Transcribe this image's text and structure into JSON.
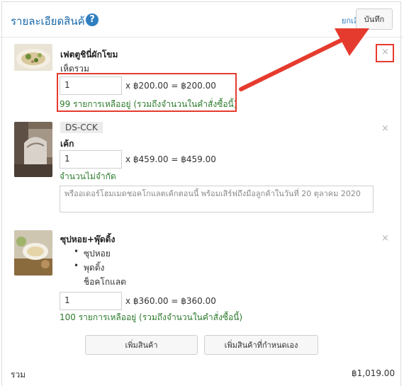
{
  "header": {
    "title": "รายละเอียดสินค้า",
    "help_glyph": "?",
    "cancel_label": "ยกเลิก",
    "save_label": "บันทึก"
  },
  "items": [
    {
      "name": "เฟตตูชินี่ผักโขม",
      "variant": "เห็ดรวม",
      "quantity": "1",
      "calc": "x ฿200.00 = ฿200.00",
      "stock": "99 รายการเหลืออยู่ (รวมถึงจำนวนในคำสั่งซื้อนี้)",
      "remove_glyph": "×"
    },
    {
      "sku": "DS-CCK",
      "name": "เค้ก",
      "quantity": "1",
      "calc": "x ฿459.00 = ฿459.00",
      "stock": "จำนวนไม่จำกัด",
      "note": "พรีออเดอร์โฮมเมดชอคโกแลตเค้กตอนนี้ พร้อมเสิร์ฟถึงมือลูกค้าในวันที่ 20 ตุลาคม 2020",
      "remove_glyph": "×"
    },
    {
      "name": "ซุปหอย+พุ๊ดดิ้ง",
      "options": [
        "ซุปหอย",
        "พุดดิ้ง"
      ],
      "option_sub": "ช็อคโกแลต",
      "quantity": "1",
      "calc": "x ฿360.00 = ฿360.00",
      "stock": "100 รายการเหลืออยู่ (รวมถึงจำนวนในคำสั่งซื้อนี้)",
      "remove_glyph": "×"
    }
  ],
  "actions": {
    "add_product": "เพิ่มสินค้า",
    "add_custom_product": "เพิ่มสินค้าที่กำหนดเอง"
  },
  "summary": {
    "total_label": "รวม",
    "total_value": "฿1,019.00"
  },
  "colors": {
    "link": "#2f7fc1",
    "stock_text": "#2d7b2d",
    "annotation": "#e53b2e"
  }
}
